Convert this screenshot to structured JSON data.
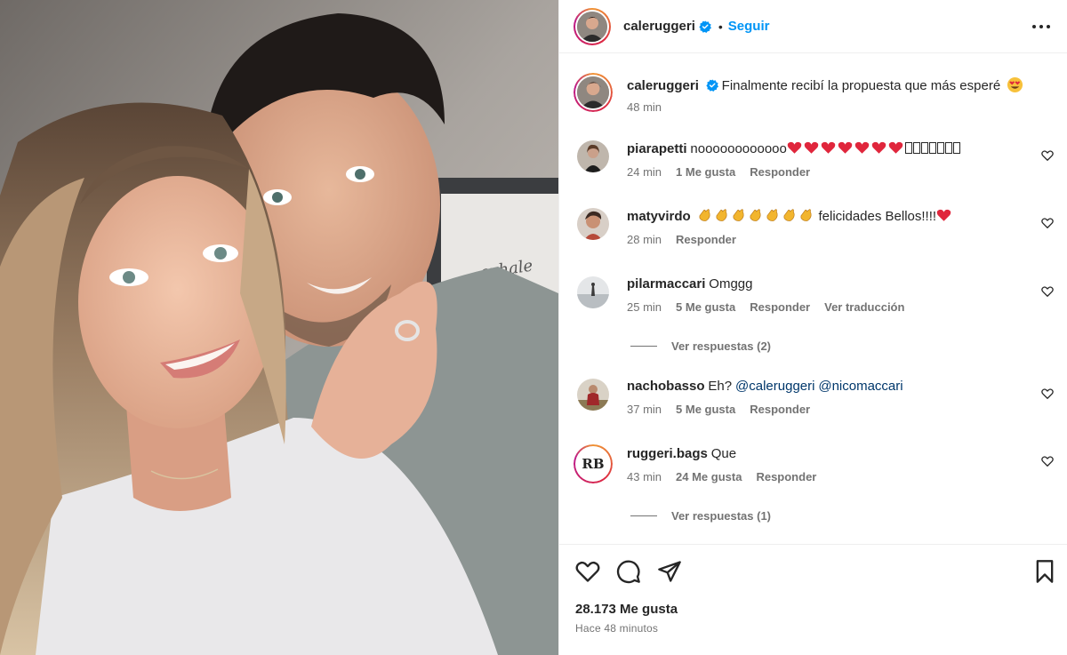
{
  "post": {
    "username": "caleruggeri",
    "follow_label": "Seguir",
    "dot": "•",
    "caption": "Finalmente recibí la propuesta que más esperé",
    "caption_emoji": "heart-eyes-emoji",
    "time": "48 min",
    "photo_text": "exhale"
  },
  "comments": [
    {
      "user": "piarapetti",
      "text": "noooooooooooo",
      "time": "24 min",
      "likes": "1 Me gusta",
      "reply": "Responder"
    },
    {
      "user": "matyvirdo",
      "text": "felicidades Bellos!!!!",
      "time": "28 min",
      "reply": "Responder"
    },
    {
      "user": "pilarmaccari",
      "text": "Omggg",
      "time": "25 min",
      "likes": "5 Me gusta",
      "reply": "Responder",
      "translate": "Ver traducción",
      "view_replies": "Ver respuestas (2)"
    },
    {
      "user": "nachobasso",
      "text": "Eh?",
      "mention1": "@caleruggeri",
      "mention2": "@nicomaccari",
      "time": "37 min",
      "likes": "5 Me gusta",
      "reply": "Responder"
    },
    {
      "user": "ruggeri.bags",
      "text": "Que",
      "avatar_text": "RB",
      "time": "43 min",
      "likes": "24 Me gusta",
      "reply": "Responder",
      "view_replies": "Ver respuestas (1)"
    }
  ],
  "footer": {
    "likes": "28.173 Me gusta",
    "ago": "Hace 48 minutos"
  },
  "colors": {
    "accent": "#0095f6",
    "muted": "#737373",
    "text": "#262626",
    "mention": "#00376b"
  }
}
